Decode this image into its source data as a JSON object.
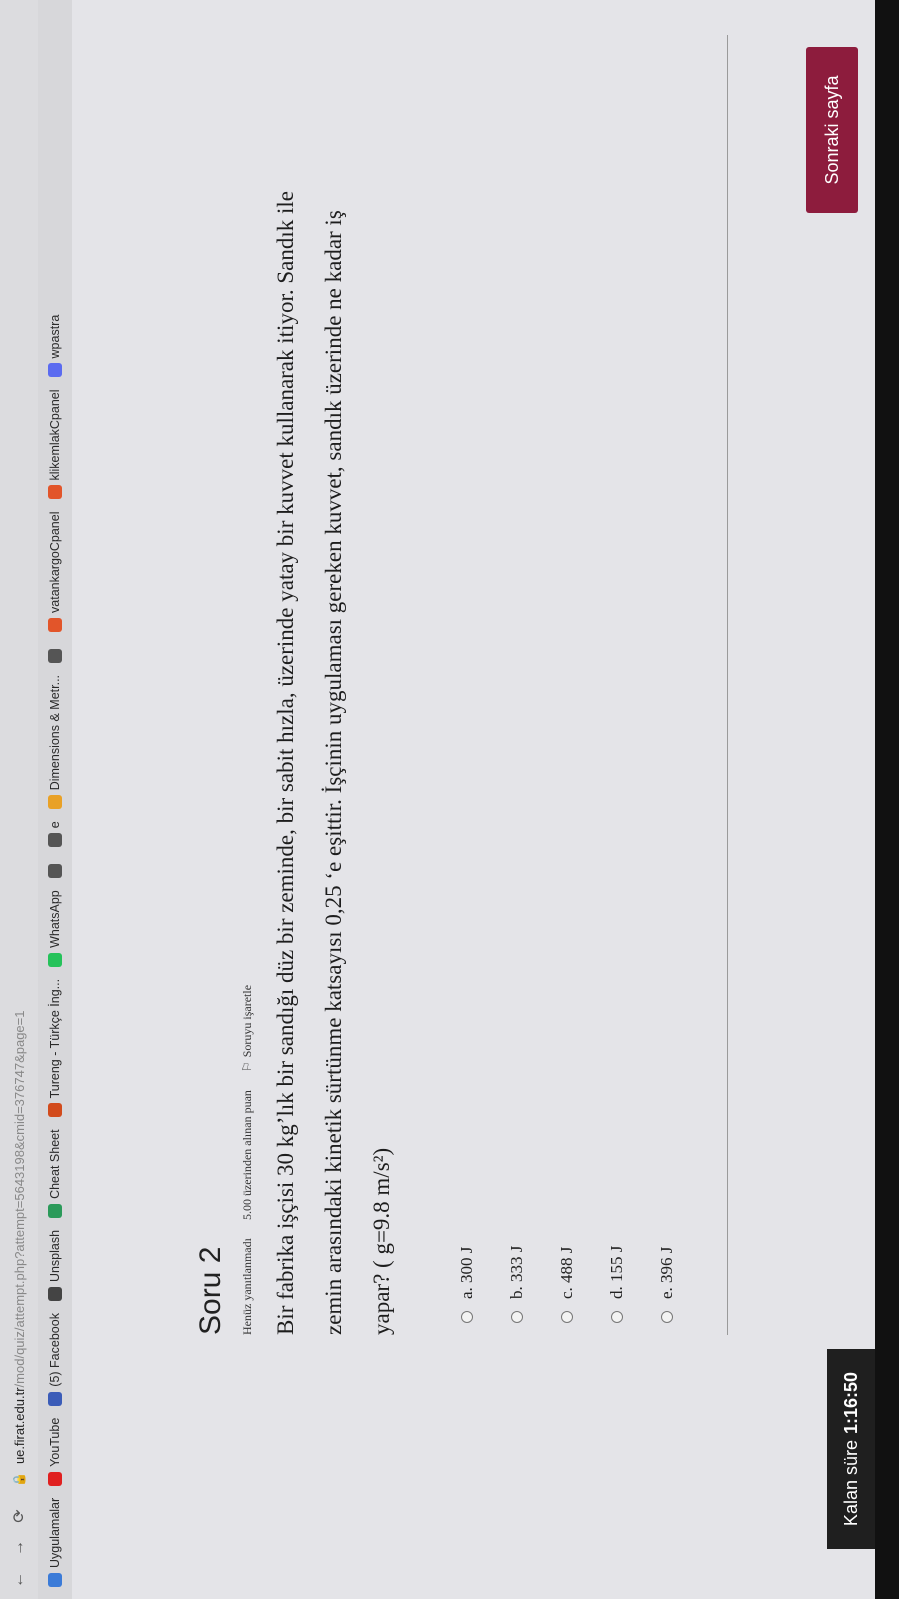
{
  "browser": {
    "host": "ue.firat.edu.tr",
    "path": "/mod/quiz/attempt.php?attempt=5643198&cmid=376747&page=1",
    "bookmarks": [
      {
        "label": "Uygulamalar",
        "icon": "apps-grid-icon",
        "color": "#3b7bd8"
      },
      {
        "label": "YouTube",
        "icon": "youtube-icon",
        "color": "#e02020"
      },
      {
        "label": "(5) Facebook",
        "icon": "facebook-icon",
        "color": "#3b5cb8"
      },
      {
        "label": "Unsplash",
        "icon": "unsplash-icon",
        "color": "#444444"
      },
      {
        "label": "Cheat Sheet",
        "icon": "checkmark-icon",
        "color": "#2b9a5a"
      },
      {
        "label": "Tureng - Türkçe İng...",
        "icon": "tureng-icon",
        "color": "#d24b1c"
      },
      {
        "label": "WhatsApp",
        "icon": "whatsapp-icon",
        "color": "#25c25a"
      },
      {
        "label": "",
        "icon": "globe-icon",
        "color": "#555555"
      },
      {
        "label": "e",
        "icon": "globe-icon",
        "color": "#555555"
      },
      {
        "label": "Dimensions & Metr...",
        "icon": "dimensions-icon",
        "color": "#e9a126"
      },
      {
        "label": "",
        "icon": "globe-icon",
        "color": "#555555"
      },
      {
        "label": "vatankargoCpanel",
        "icon": "cpanel-icon",
        "color": "#e2552a"
      },
      {
        "label": "klikemlakCpanel",
        "icon": "cpanel-icon",
        "color": "#e2552a"
      },
      {
        "label": "wpastra",
        "icon": "astra-icon",
        "color": "#5b6bf0"
      }
    ]
  },
  "question": {
    "title": "Soru 2",
    "status": "Henüz yanıtlanmadı",
    "points": "5.00 üzerinden alınan puan",
    "flag_label": "Soruyu işaretle",
    "text": "Bir fabrika işçisi 30 kg’lık bir sandığı düz bir zeminde, bir sabit hızla, üzerinde yatay bir kuvvet kullanarak itiyor. Sandık ile zemin arasındaki kinetik sürtünme katsayısı 0,25 ‘e eşittir. İşçinin uygulaması gereken kuvvet, sandık üzerinde ne kadar iş yapar? ( g=9.8 m/s²)",
    "options": [
      "a. 300 J",
      "b. 333 J",
      "c. 488 J",
      "d. 155 J",
      "e. 396 J"
    ]
  },
  "next_button": "Sonraki sayfa",
  "timer": {
    "label": "Kalan süre",
    "value": "1:16:50"
  }
}
